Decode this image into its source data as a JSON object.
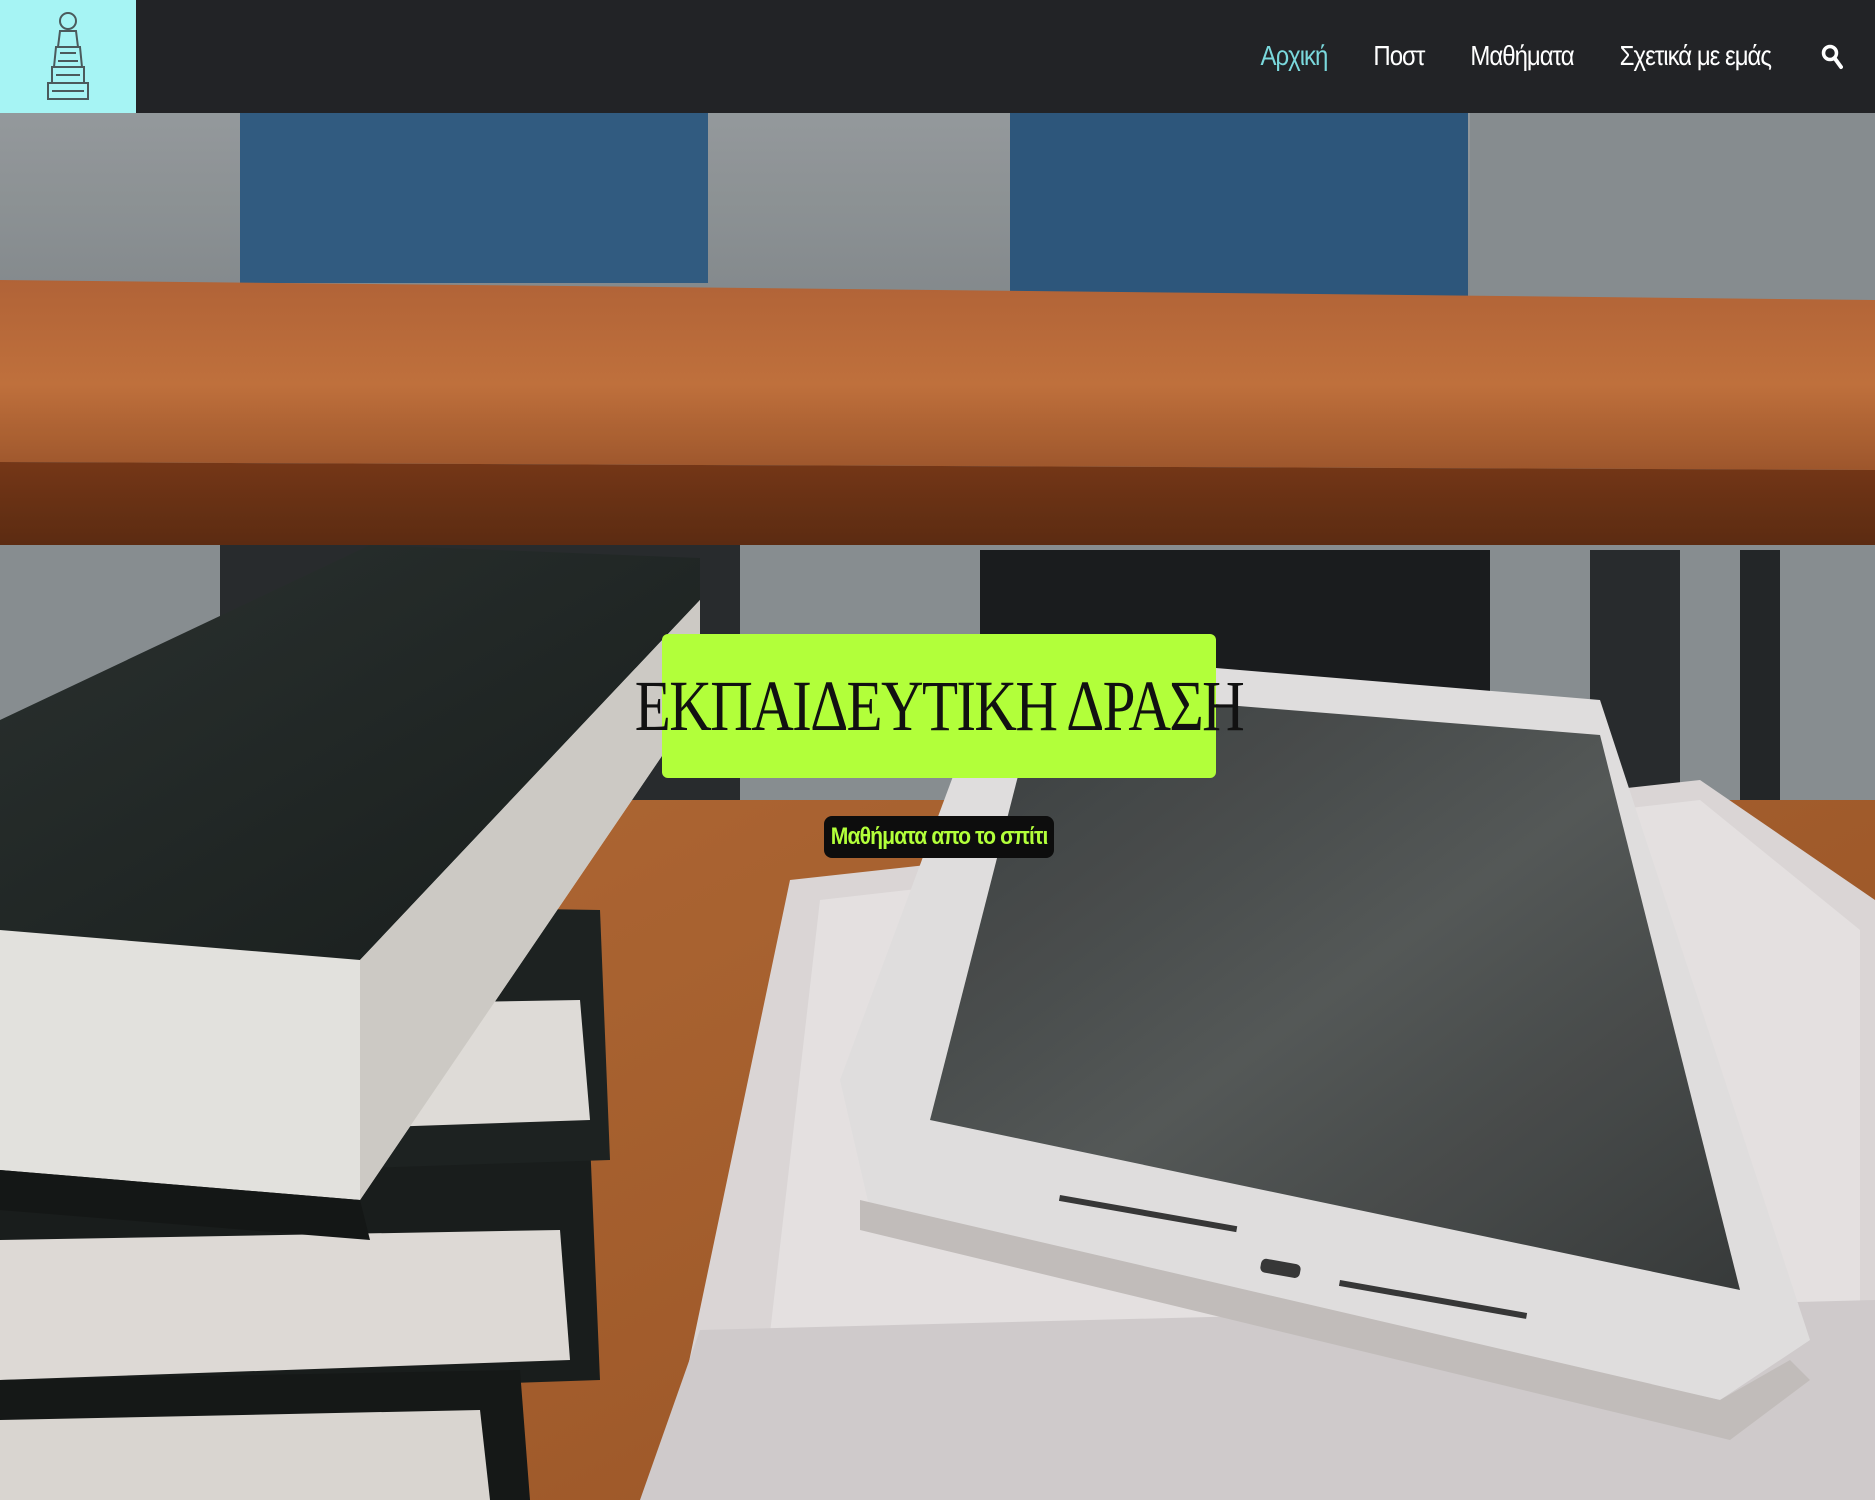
{
  "header": {
    "logo_icon": "statue-logo-icon",
    "nav": [
      {
        "label": "Αρχική",
        "active": true
      },
      {
        "label": "Ποστ",
        "active": false
      },
      {
        "label": "Μαθήματα",
        "active": false
      },
      {
        "label": "Σχετικά με εμάς",
        "active": false
      }
    ],
    "search_icon": "search-icon"
  },
  "hero": {
    "title": "ΕΚΠΑΙΔΕΥΤΙΚΗ ΔΡΑΣΗ",
    "subtitle": "Μαθήματα απο το σπίτι"
  },
  "colors": {
    "topbar": "#222326",
    "logo_bg": "#a6f4f4",
    "nav_active": "#7ad8dc",
    "accent_lime": "#b2ff3a"
  }
}
